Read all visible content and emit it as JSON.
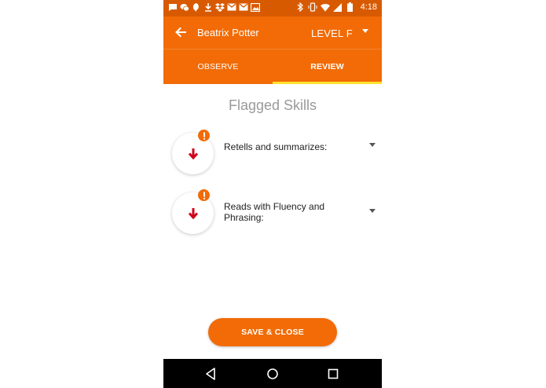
{
  "status_bar": {
    "time": "4:18",
    "left_icons": [
      "chat-bubble-icon",
      "wechat-icon",
      "hangouts-icon",
      "download-icon",
      "dropbox-icon",
      "gmail-icon",
      "gmail-icon",
      "gallery-icon"
    ],
    "right_icons": [
      "bluetooth-icon",
      "vibrate-icon",
      "wifi-icon",
      "signal-icon",
      "battery-icon"
    ]
  },
  "app_bar": {
    "back_icon": "arrow-left-icon",
    "title": "Beatrix Potter",
    "level": "LEVEL F"
  },
  "tabs": [
    {
      "label": "OBSERVE",
      "active": false
    },
    {
      "label": "REVIEW",
      "active": true
    }
  ],
  "review": {
    "section_title": "Flagged Skills",
    "skills": [
      {
        "label": "Retells and summarizes:"
      },
      {
        "label": "Reads with Fluency and Phrasing:"
      }
    ]
  },
  "actions": {
    "save_close": "SAVE & CLOSE"
  },
  "colors": {
    "primary": "#f26b06",
    "status_bar": "#d85a00",
    "tab_indicator": "#ffe12e",
    "arrow": "#d0021b",
    "title_gray": "#9a9a9a"
  }
}
